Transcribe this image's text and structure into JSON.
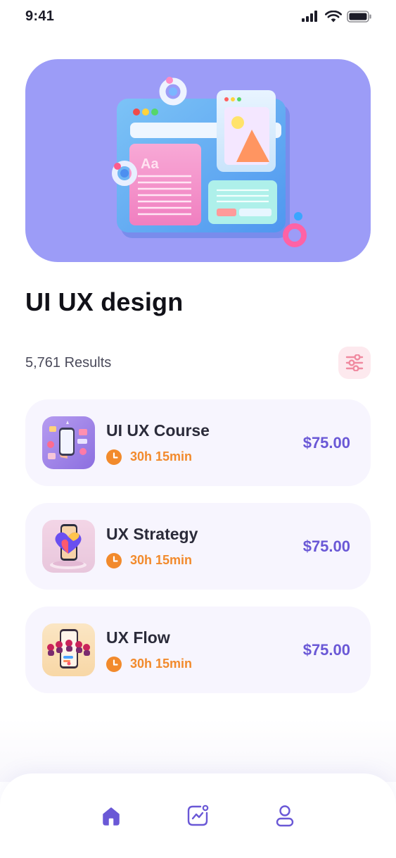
{
  "status_bar": {
    "time": "9:41"
  },
  "hero": {
    "illustration_text": "Aa"
  },
  "page": {
    "title": "UI UX design",
    "results": "5,761 Results"
  },
  "courses": [
    {
      "title": "UI UX Course",
      "duration": "30h 15min",
      "price": "$75.00",
      "thumb": "phone-social-illustration"
    },
    {
      "title": "UX Strategy",
      "duration": "30h 15min",
      "price": "$75.00",
      "thumb": "heart-phone-illustration"
    },
    {
      "title": "UX Flow",
      "duration": "30h 15min",
      "price": "$75.00",
      "thumb": "people-phone-illustration"
    }
  ],
  "nav": {
    "items": [
      {
        "name": "home",
        "icon": "home-icon",
        "active": true
      },
      {
        "name": "stats",
        "icon": "chart-icon",
        "active": false
      },
      {
        "name": "profile",
        "icon": "user-icon",
        "active": false
      }
    ]
  },
  "colors": {
    "accent": "#6a58d6",
    "hero_bg": "#9c9cf7",
    "card_bg": "#f7f5fe",
    "duration": "#f28a2c",
    "filter_bg": "#fde9ee",
    "filter_icon": "#f08aa0"
  }
}
